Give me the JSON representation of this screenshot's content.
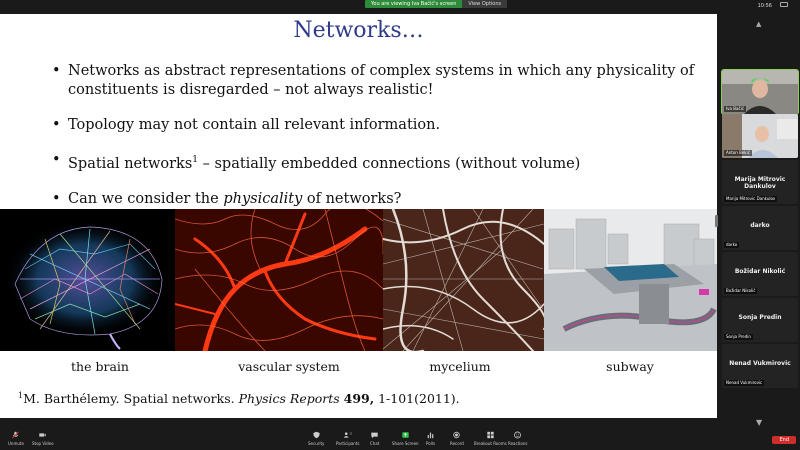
{
  "banner": {
    "message": "You are viewing Iva Bačić's screen",
    "options_label": "View Options"
  },
  "clock": "10:56",
  "slide": {
    "title": "Networks…",
    "bullets": [
      {
        "text": "Networks as abstract representations of complex systems in which any physicality of constituents is disregarded – not always realistic!"
      },
      {
        "text": "Topology may not contain all relevant information."
      },
      {
        "pre": "Spatial networks",
        "sup": "1",
        "post": " – spatially embedded connections (without volume)"
      },
      {
        "pre": "Can we consider the ",
        "em": "physicality",
        "post": " of networks?"
      }
    ],
    "captions": [
      "the brain",
      "vascular system",
      "mycelium",
      "subway"
    ],
    "footnote": {
      "sup": "1",
      "authors": "M. Barthélemy. Spatial networks. ",
      "journal": "Physics Reports",
      "volume": "499,",
      "pages": " 1-101(2011)."
    }
  },
  "participants": [
    {
      "name": "Iva Bačić",
      "video": true,
      "active": true
    },
    {
      "name": "Anton Bekić",
      "video": true,
      "active": false
    },
    {
      "name": "Marija Mitrovic Dankulov",
      "label": "Marija Mitrovic Dankulov",
      "video": false
    },
    {
      "name": "darko",
      "label": "darko",
      "video": false
    },
    {
      "name": "Božidar Nikolić",
      "label": "Božidar Nikolić",
      "video": false
    },
    {
      "name": "Sonja Predin",
      "label": "Sonja Predin",
      "video": false
    },
    {
      "name": "Nenad Vukmirovic",
      "label": "Nenad Vukmirovic",
      "video": false
    }
  ],
  "toolbar": {
    "unmute": "Unmute",
    "stop_video": "Stop Video",
    "security": "Security",
    "participants": "Participants",
    "participants_count": "10",
    "chat": "Chat",
    "share_screen": "Share Screen",
    "polls": "Polls",
    "record": "Record",
    "breakout_rooms": "Breakout Rooms",
    "reactions": "Reactions",
    "end": "End"
  },
  "colors": {
    "title": "#2e3b8a",
    "share_green": "#2e8b3a",
    "end_red": "#d02c2c",
    "active_speaker": "#8bd448"
  }
}
